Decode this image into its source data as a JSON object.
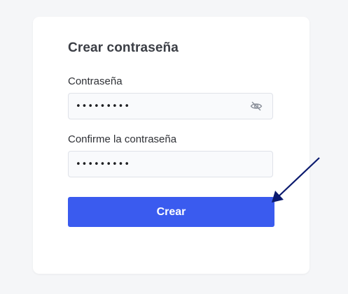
{
  "form": {
    "title": "Crear contraseña",
    "password_label": "Contraseña",
    "password_value": "•••••••••",
    "confirm_label": "Confirme la contraseña",
    "confirm_value": "•••••••••",
    "submit_label": "Crear"
  },
  "icons": {
    "visibility_toggle": "eye-slash-icon",
    "annotation": "arrow-icon"
  },
  "colors": {
    "primary": "#3a5bef",
    "annotation_arrow": "#0b1a6e"
  }
}
